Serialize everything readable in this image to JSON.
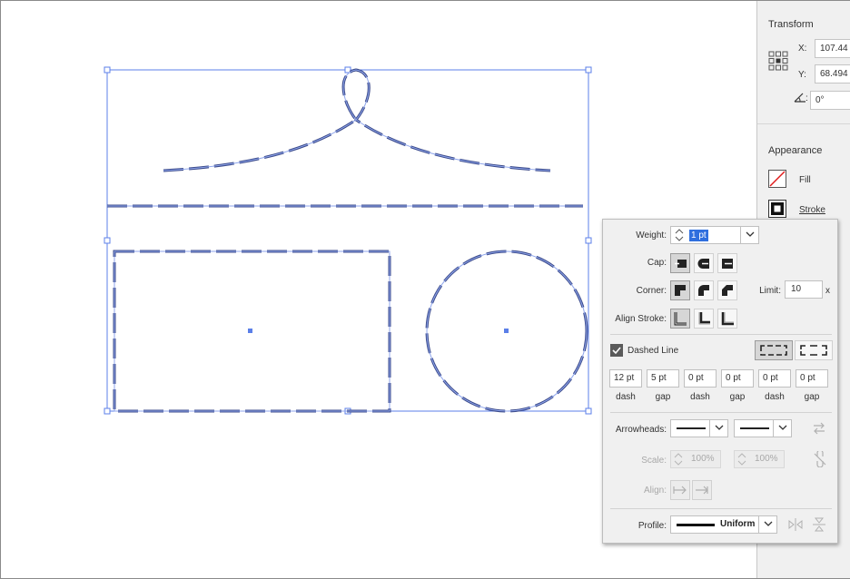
{
  "properties_panel": {
    "transform": {
      "title": "Transform",
      "x_label": "X:",
      "x_value": "107.44",
      "y_label": "Y:",
      "y_value": "68.494",
      "angle_label": ":",
      "angle_value": "0°"
    },
    "appearance": {
      "title": "Appearance",
      "fill_label": "Fill",
      "stroke_label": "Stroke"
    }
  },
  "stroke_panel": {
    "weight_label": "Weight:",
    "weight_value": "1 pt",
    "cap_label": "Cap:",
    "corner_label": "Corner:",
    "limit_label": "Limit:",
    "limit_value": "10",
    "limit_unit": "x",
    "align_label": "Align Stroke:",
    "dashed_label": "Dashed Line",
    "dashed_checked": true,
    "dash_fields": [
      {
        "value": "12 pt",
        "label": "dash"
      },
      {
        "value": "5 pt",
        "label": "gap"
      },
      {
        "value": "0 pt",
        "label": "dash"
      },
      {
        "value": "0 pt",
        "label": "gap"
      },
      {
        "value": "0 pt",
        "label": "dash"
      },
      {
        "value": "0 pt",
        "label": "gap"
      }
    ],
    "arrowheads_label": "Arrowheads:",
    "scale_label": "Scale:",
    "scale_start": "100%",
    "scale_end": "100%",
    "align_arrow_label": "Align:",
    "profile_label": "Profile:",
    "profile_value": "Uniform"
  },
  "colors": {
    "selection": "#5b7fe8",
    "stroke": "#3b4a8a",
    "panel_bg": "#f0f0f0",
    "fill_none": "#e01b1b"
  }
}
